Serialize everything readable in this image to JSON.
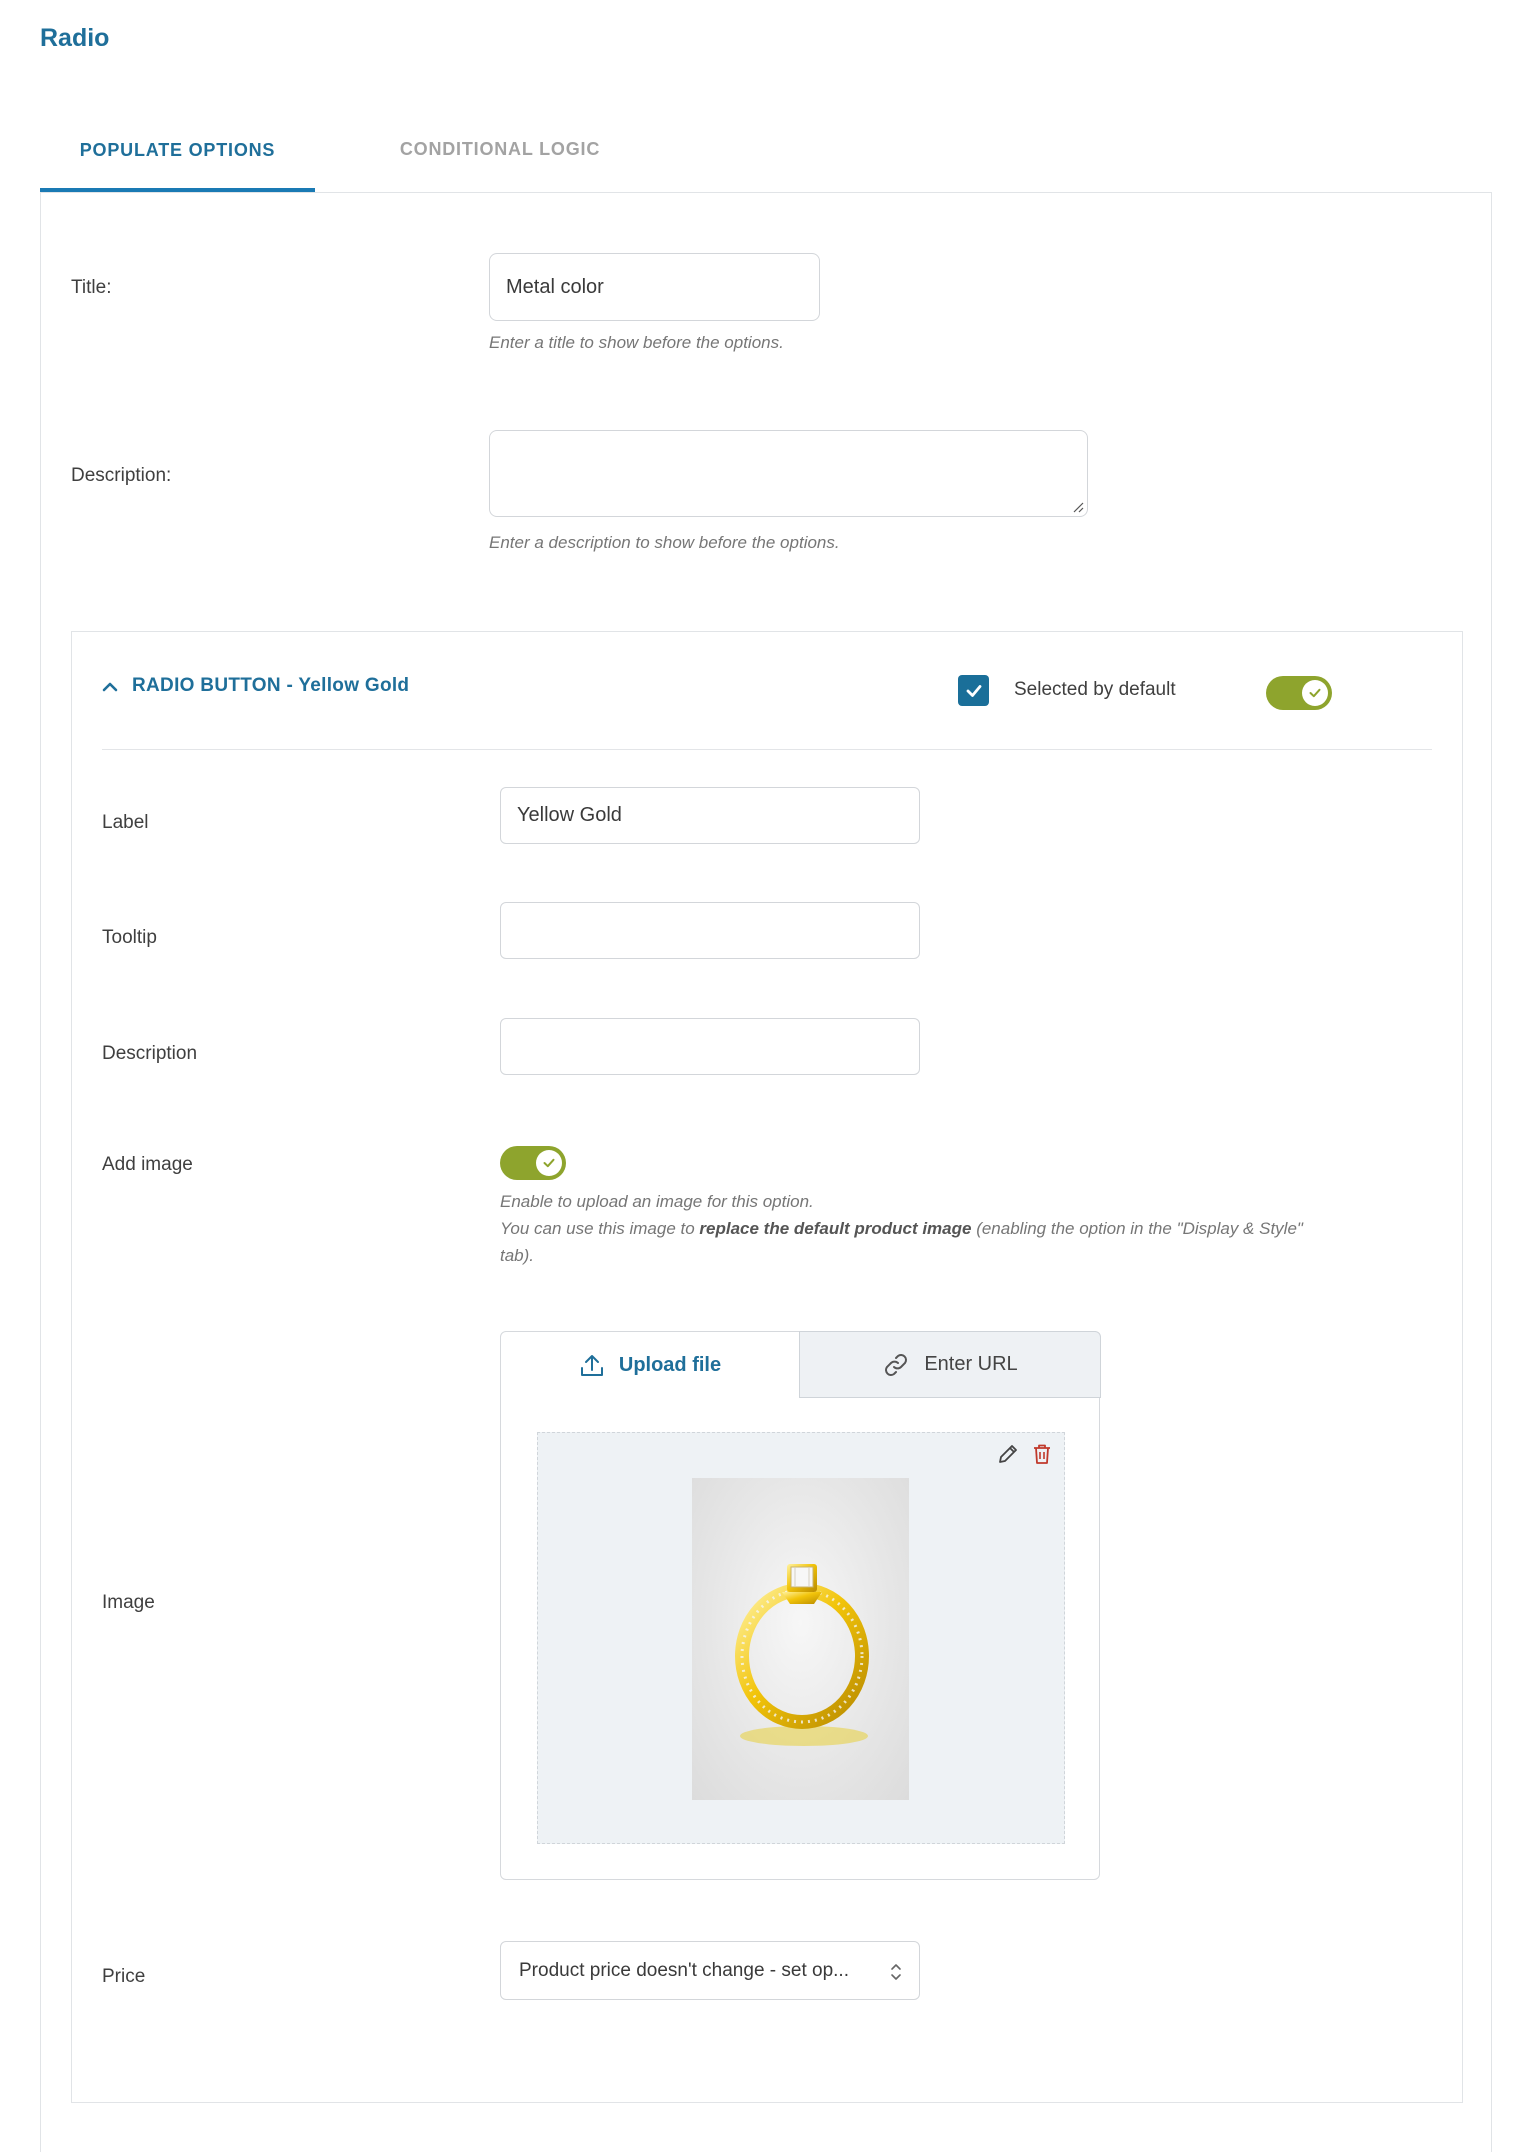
{
  "page": {
    "title": "Radio"
  },
  "tabs": [
    {
      "label": "POPULATE OPTIONS",
      "active": true
    },
    {
      "label": "CONDITIONAL LOGIC",
      "active": false
    }
  ],
  "fields": {
    "title": {
      "label": "Title:",
      "value": "Metal color",
      "help": "Enter a title to show before the options."
    },
    "description": {
      "label": "Description:",
      "value": "",
      "help": "Enter a description to show before the options."
    }
  },
  "option": {
    "header": "RADIO BUTTON - Yellow Gold",
    "selected_by_default_label": "Selected by default",
    "selected_by_default": true,
    "enabled": true,
    "label_field": {
      "label": "Label",
      "value": "Yellow Gold"
    },
    "tooltip_field": {
      "label": "Tooltip",
      "value": ""
    },
    "description_field": {
      "label": "Description",
      "value": ""
    },
    "add_image": {
      "label": "Add image",
      "enabled": true,
      "help_line1": "Enable to upload an image for this option.",
      "help_line2_pre": "You can use this image to ",
      "help_line2_bold": "replace the default product image",
      "help_line2_post": " (enabling the option in the \"Display & Style\"",
      "help_line3": "tab)."
    },
    "image": {
      "label": "Image",
      "upload_tab": "Upload file",
      "url_tab": "Enter URL"
    },
    "price": {
      "label": "Price",
      "selected": "Product price doesn't change - set op..."
    }
  },
  "colors": {
    "accent": "#1f6f9a",
    "toggle_on": "#8ea42d",
    "delete": "#c0392b"
  }
}
